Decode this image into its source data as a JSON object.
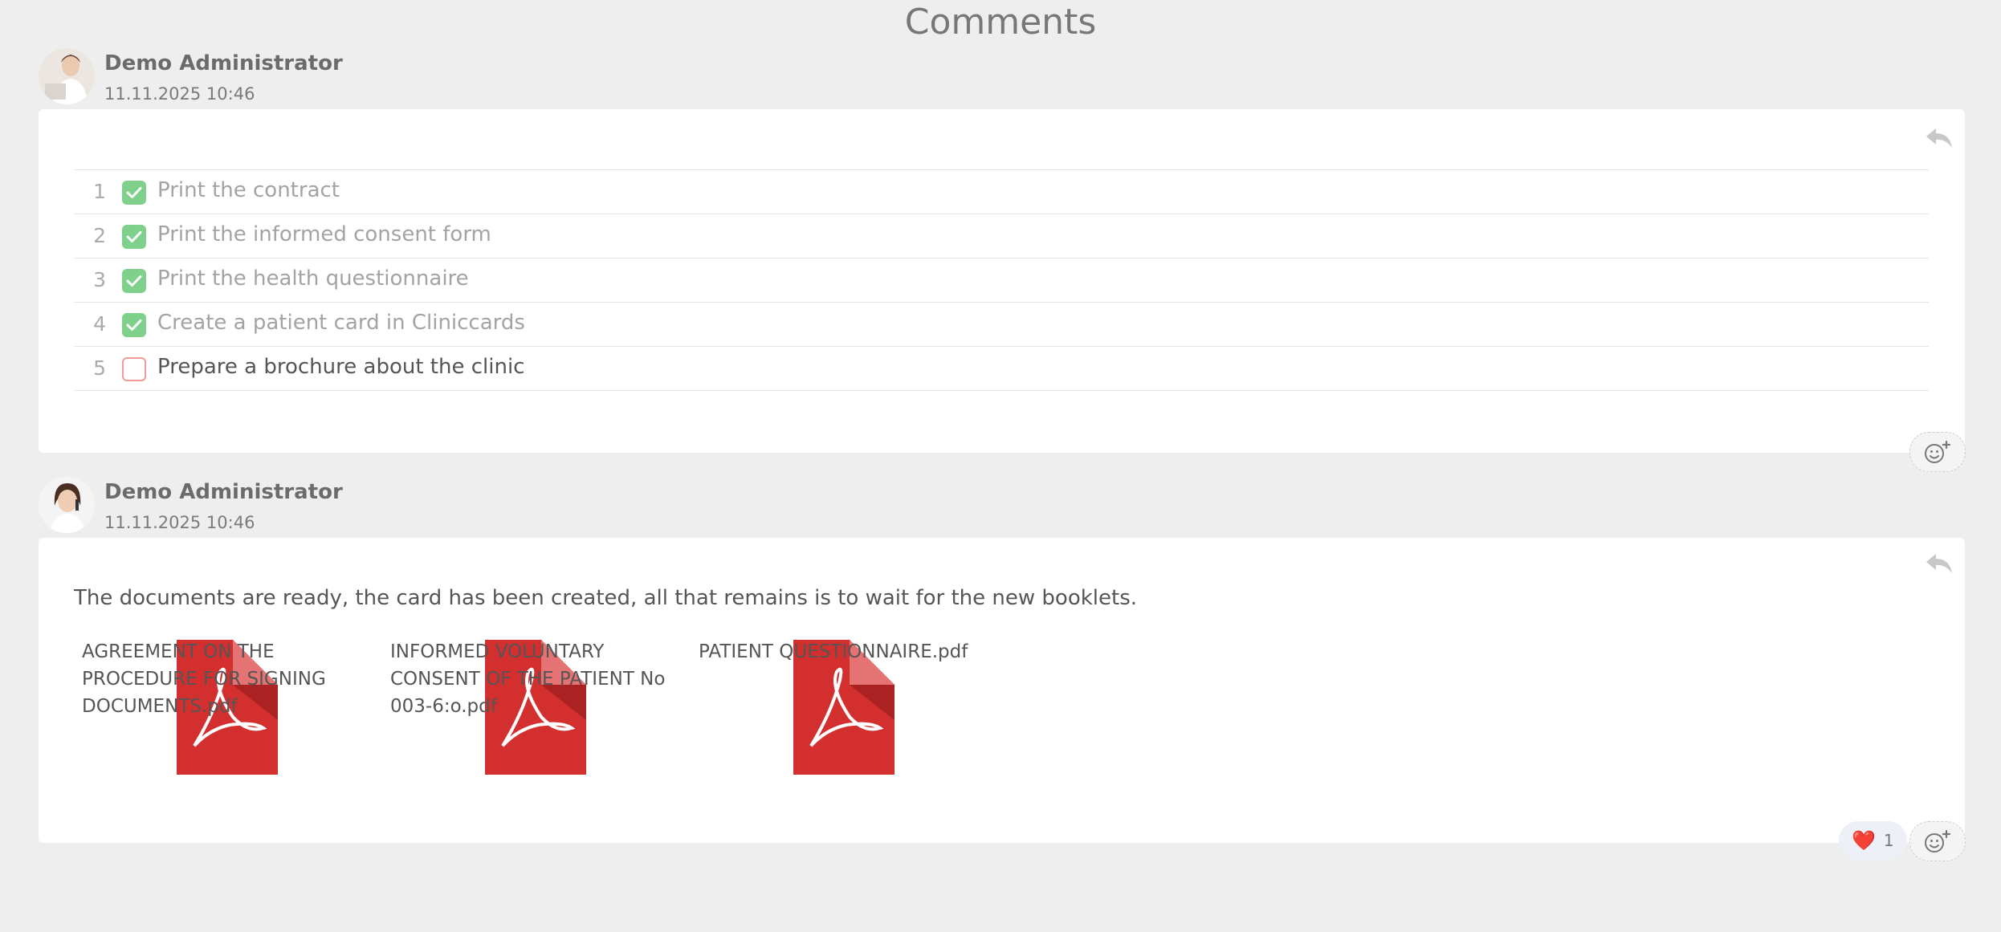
{
  "page": {
    "title": "Comments"
  },
  "comments": [
    {
      "author": "Demo Administrator",
      "date": "11.11.2025 10:46",
      "checklist": [
        {
          "num": "1",
          "text": "Print the contract",
          "checked": true
        },
        {
          "num": "2",
          "text": "Print the informed consent form",
          "checked": true
        },
        {
          "num": "3",
          "text": "Print the health questionnaire",
          "checked": true
        },
        {
          "num": "4",
          "text": "Create a patient card in Cliniccards",
          "checked": true
        },
        {
          "num": "5",
          "text": "Prepare a brochure about the clinic",
          "checked": false
        }
      ],
      "icons": {
        "reply": "reply-icon",
        "add_reaction": "add-reaction-icon"
      }
    },
    {
      "author": "Demo Administrator",
      "date": "11.11.2025 10:46",
      "text": "The documents are ready, the card has been created, all that remains is to wait for the new booklets.",
      "attachments": [
        {
          "name": "AGREEMENT ON THE PROCEDURE FOR SIGNING DOCUMENTS.pdf",
          "icon": "pdf-icon"
        },
        {
          "name": "INFORMED VOLUNTARY CONSENT OF THE PATIENT No 003-6:o.pdf",
          "icon": "pdf-icon"
        },
        {
          "name": "PATIENT QUESTIONNAIRE.pdf",
          "icon": "pdf-icon"
        }
      ],
      "reactions": [
        {
          "emoji": "❤️",
          "count": "1"
        }
      ],
      "icons": {
        "reply": "reply-icon",
        "add_reaction": "add-reaction-icon"
      }
    }
  ],
  "colors": {
    "background": "#eeeeee",
    "card": "#ffffff",
    "checked": "#7fd08a",
    "unchecked_border": "#ef9b9b",
    "pdf_red": "#d32f2f"
  }
}
